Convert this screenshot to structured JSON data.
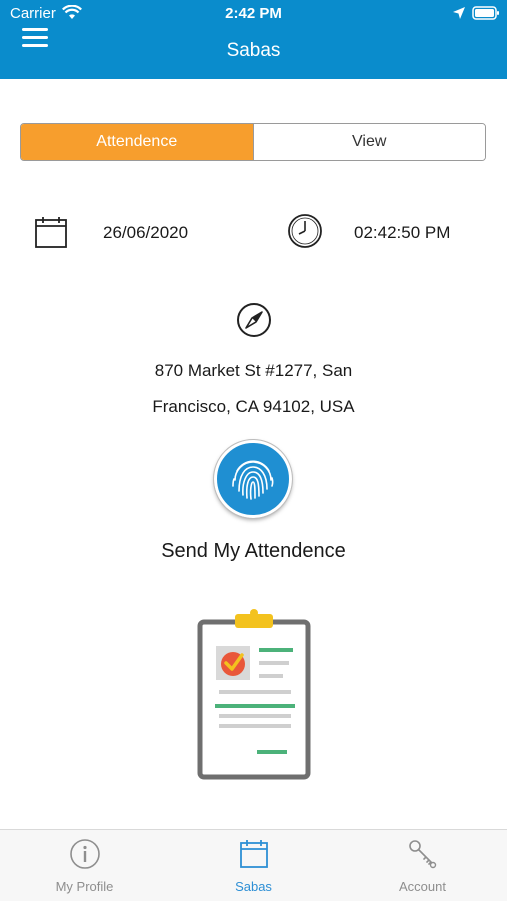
{
  "status_bar": {
    "carrier": "Carrier",
    "time": "2:42 PM"
  },
  "header": {
    "title": "Sabas",
    "color": "#0a8ccc"
  },
  "segment": {
    "attendance_label": "Attendence",
    "view_label": "View",
    "active_color": "#f79e2d"
  },
  "attendance": {
    "date": "26/06/2020",
    "time": "02:42:50 PM",
    "address_line1": "870 Market St #1277, San",
    "address_line2": "Francisco, CA 94102, USA",
    "send_label": "Send My Attendence"
  },
  "icons": {
    "menu": "hamburger-menu-icon",
    "calendar": "calendar-icon",
    "clock": "clock-icon",
    "compass": "compass-icon",
    "fingerprint": "fingerprint-icon"
  },
  "tabbar": {
    "items": [
      {
        "label": "My Profile",
        "icon": "info-icon",
        "active": false
      },
      {
        "label": "Sabas",
        "icon": "calendar-icon",
        "active": true
      },
      {
        "label": "Account",
        "icon": "key-icon",
        "active": false
      }
    ],
    "active_color": "#2d8fd5"
  }
}
